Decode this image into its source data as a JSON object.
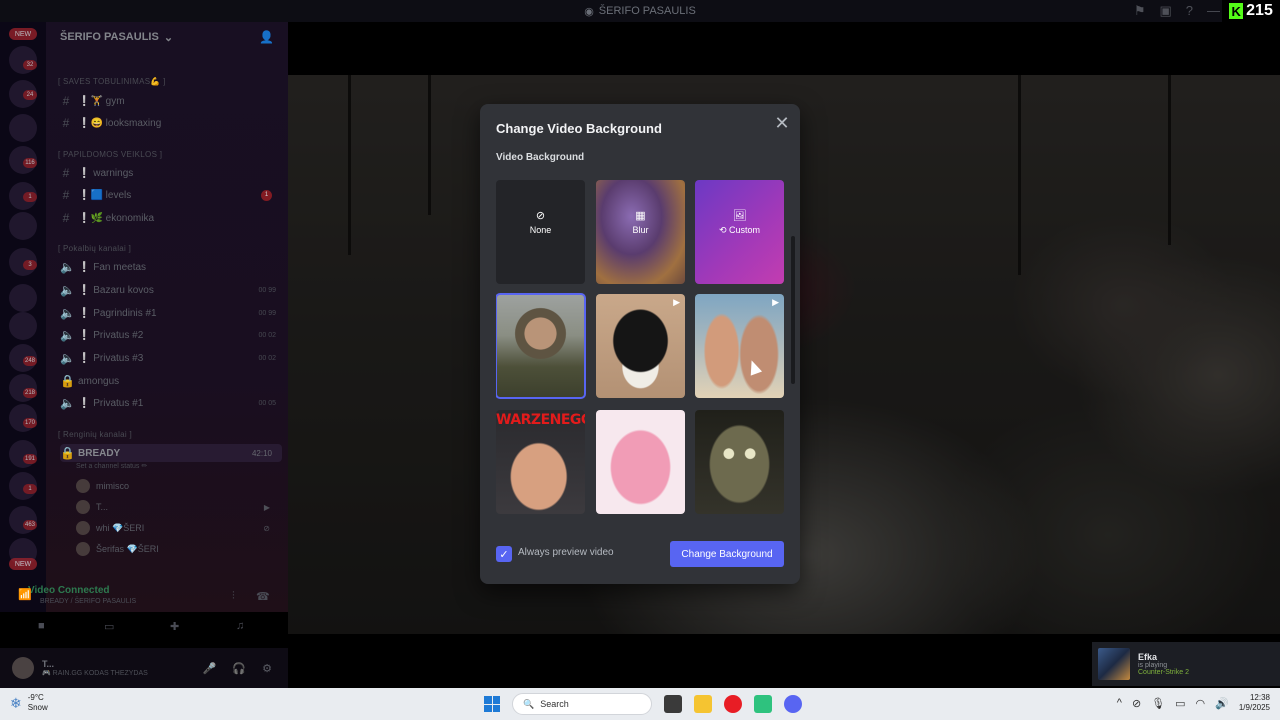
{
  "window": {
    "title": "ŠERIFO PASAULIS",
    "kick_count": "215"
  },
  "server": {
    "name": "ŠERIFO PASAULIS"
  },
  "guild_badges": [
    "NEW",
    "32",
    "24",
    "116",
    "1",
    "3",
    "248",
    "218",
    "170",
    "191",
    "1",
    "463",
    "NEW"
  ],
  "categories": {
    "saves": "[ SAVES TOBULINIMAS💪 ]",
    "papildomos": "[ PAPILDOMOS VEIKLOS ]",
    "pokalbiu": "[ Pokalbių kanalai ]",
    "renginiu": "[ Renginių kanalai ]"
  },
  "channels": {
    "gym": "❕🏋️ gym",
    "looksmaxing": "❕😄 looksmaxing",
    "warnings": "❕ warnings",
    "levels": "❕🟦 levels",
    "levels_badge": "1",
    "ekonomika": "❕🌿 ekonomika",
    "fan_meetas": "❕ Fan meetas",
    "bazaru_kovos": "❕ Bazaru kovos",
    "bazaru_count": "00 99",
    "pagrindinis": "❕ Pagrindinis #1",
    "pagrindinis_count": "00 99",
    "privatus2": "❕ Privatus #2",
    "privatus2_count": "00 02",
    "privatus3": "❕ Privatus #3",
    "privatus3_count": "00 02",
    "amongus": "amongus",
    "privatus1": "❕ Privatus #1",
    "privatus1_count": "00 05",
    "bready": "BREADY",
    "bready_time": "42:10",
    "bready_status": "Set a channel status ✏"
  },
  "voice_users": [
    "mimisco",
    "T...",
    "whi 💎ŠERI",
    "Šerifas 💎ŠERI"
  ],
  "voice_panel": {
    "status": "Video Connected",
    "sub": "BREADY / ŠERIFO PASAULIS"
  },
  "user_panel": {
    "name": "T...",
    "status": "🎮 RAIN.GG KODAS THEZYDAS"
  },
  "modal": {
    "title": "Change Video Background",
    "section": "Video Background",
    "tiles": {
      "none": "None",
      "blur": "Blur",
      "custom": "Custom"
    },
    "bald_banner": "WARZENEGG",
    "checkbox_label": "Always preview video",
    "checkbox_checked": true,
    "primary_button": "Change Background",
    "accent": "#5865f2"
  },
  "toast": {
    "user": "Efka",
    "activity": "is playing",
    "game": "Counter-Strike 2"
  },
  "taskbar": {
    "weather_temp": "-9°C",
    "weather_desc": "Snow",
    "search_placeholder": "Search",
    "time": "12:38",
    "date": "1/9/2025"
  }
}
